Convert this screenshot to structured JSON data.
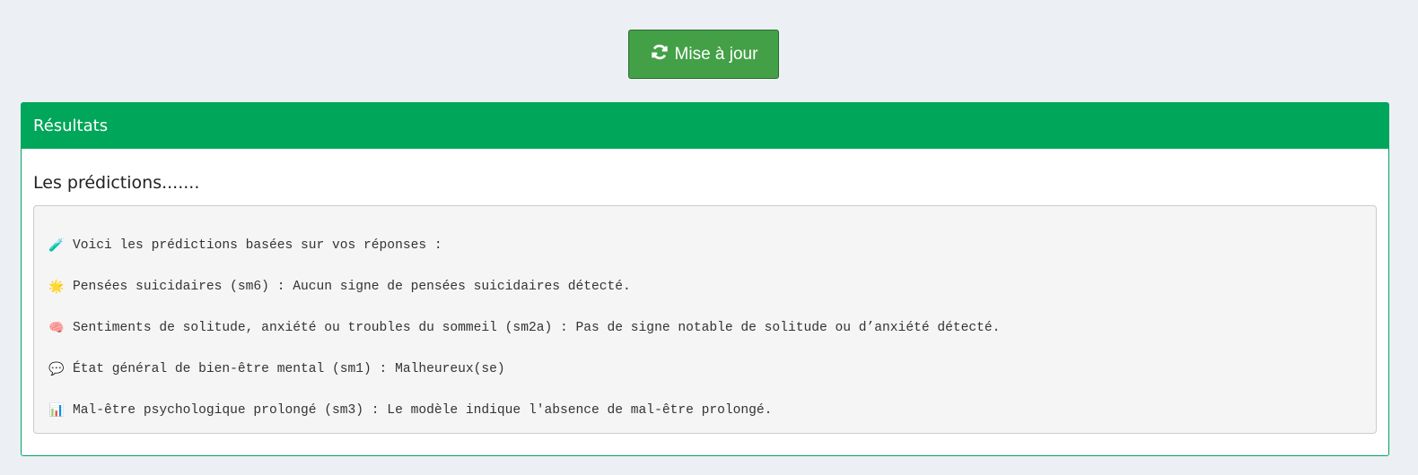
{
  "toolbar": {
    "update_label": "Mise à jour",
    "update_icon": "refresh-icon",
    "button_color": "#43a047"
  },
  "panel": {
    "title": "Résultats",
    "header_color": "#00a65a",
    "subtitle": "Les prédictions.......",
    "lines": [
      {
        "icon": "test-tube-icon",
        "emoji": "🧪",
        "text": "Voici les prédictions basées sur vos réponses :"
      },
      {
        "icon": "star-icon",
        "emoji": "🌟",
        "text": "Pensées suicidaires (sm6) : Aucun signe de pensées suicidaires détecté."
      },
      {
        "icon": "brain-icon",
        "emoji": "🧠",
        "text": "Sentiments de solitude, anxiété ou troubles du sommeil (sm2a) : Pas de signe notable de solitude ou d’anxiété détecté."
      },
      {
        "icon": "speech-bubble-icon",
        "emoji": "💬",
        "text": "État général de bien-être mental (sm1) : Malheureux(se)"
      },
      {
        "icon": "bar-chart-icon",
        "emoji": "📊",
        "text": "Mal-être psychologique prolongé (sm3) : Le modèle indique l'absence de mal-être prolongé."
      }
    ]
  }
}
